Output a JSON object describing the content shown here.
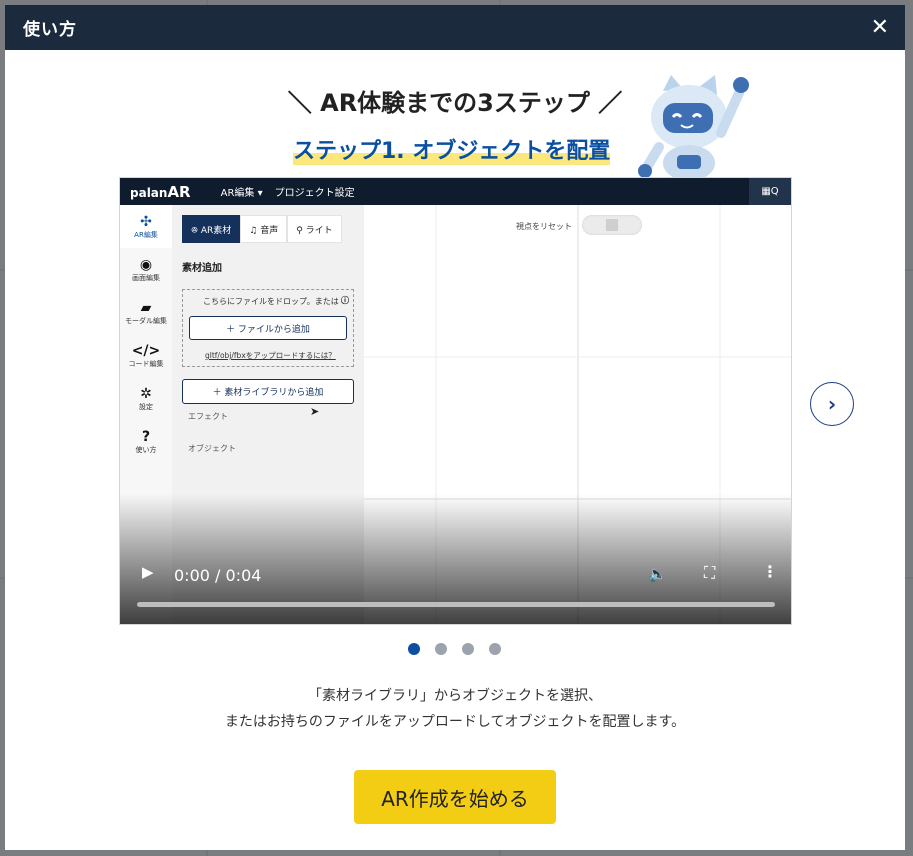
{
  "modal": {
    "title": "使い方",
    "close_icon": "close-icon"
  },
  "heading": {
    "text": "＼ AR体験までの3ステップ ／"
  },
  "step": {
    "title": "ステップ1. オブジェクトを配置"
  },
  "video_app": {
    "logo_small": "palan",
    "logo_big": "AR",
    "menu_ar_edit": "AR編集 ▾",
    "menu_project": "プロジェクト設定",
    "qr_label": "Q",
    "rail": [
      {
        "icon": "✣",
        "label": "AR編集"
      },
      {
        "icon": "◉",
        "label": "画面編集"
      },
      {
        "icon": "▰",
        "label": "モーダル編集"
      },
      {
        "icon": "</>",
        "label": "コード編集"
      },
      {
        "icon": "✲",
        "label": "設定"
      },
      {
        "icon": "?",
        "label": "使い方"
      }
    ],
    "tabs": [
      "ꔮ AR素材",
      "♫ 音声",
      "⚲ ライト"
    ],
    "panel_title": "素材追加",
    "drop_text": "こちらにファイルをドロップ。または",
    "drop_info": "ⓘ",
    "file_button": "＋ ファイルから追加",
    "drop_help": "gltf/obj/fbxをアップロードするには？",
    "library_button": "＋ 素材ライブラリから追加",
    "section_effect": "エフェクト",
    "section_object": "オブジェクト",
    "reset_label": "視点をリセット"
  },
  "video_controls": {
    "time": "0:00 / 0:04",
    "progress": 0
  },
  "carousel": {
    "current": 1,
    "total": 4
  },
  "description": {
    "line1": "「素材ライブラリ」からオブジェクトを選択、",
    "line2": "またはお持ちのファイルをアップロードしてオブジェクトを配置します。"
  },
  "cta": {
    "label": "AR作成を始める"
  },
  "colors": {
    "header_bg": "#1b2a3d",
    "accent_blue": "#0a4fa0",
    "highlight_yellow": "#fbe77a",
    "cta_yellow": "#f3cd14",
    "dot_inactive": "#9ca3ad"
  }
}
